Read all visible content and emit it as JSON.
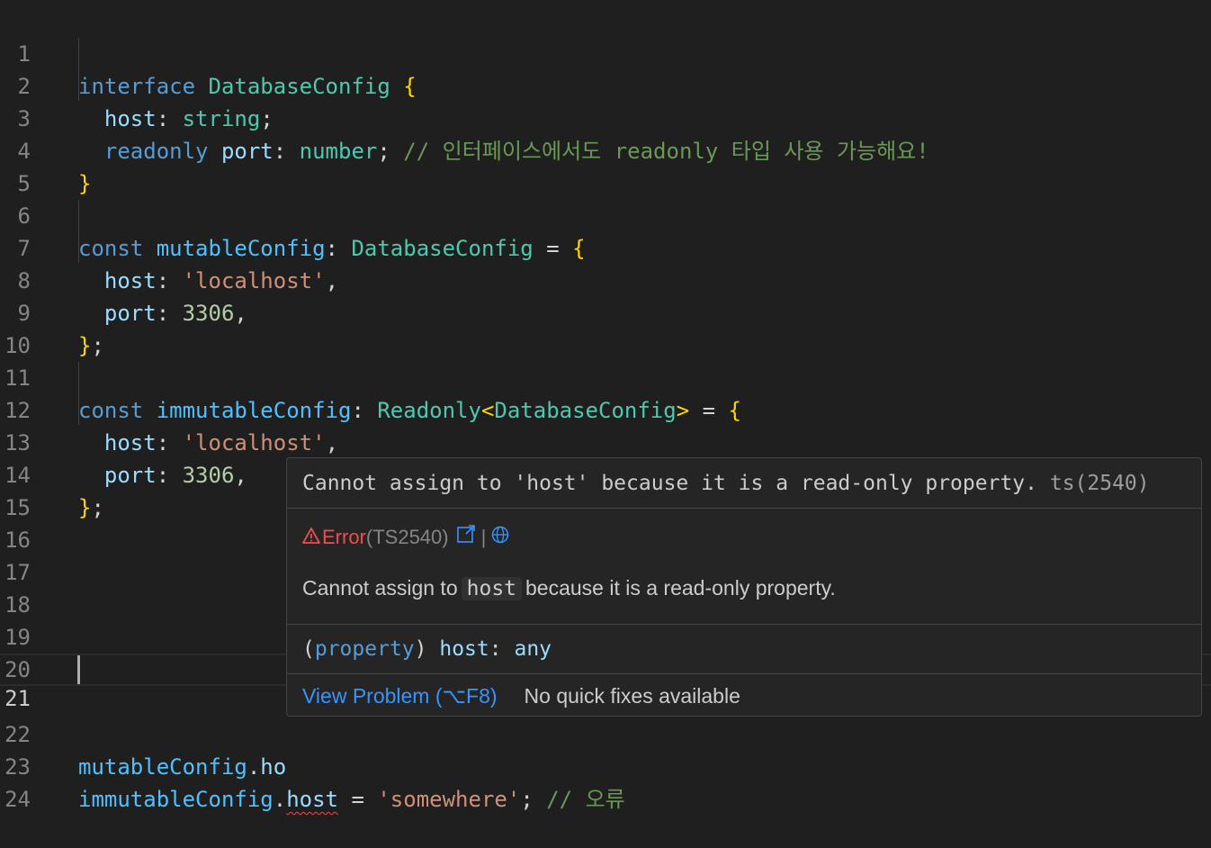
{
  "editor": {
    "line_numbers": [
      "1",
      "2",
      "3",
      "4",
      "5",
      "6",
      "7",
      "8",
      "9",
      "10",
      "11",
      "12",
      "13",
      "14",
      "15",
      "16",
      "17",
      "18",
      "19",
      "20",
      "21",
      "22",
      "23",
      "24"
    ],
    "tokens": {
      "l1": [
        "interface",
        "DatabaseConfig",
        "{"
      ],
      "l2": [
        "host",
        ":",
        "string",
        ";"
      ],
      "l3": [
        "readonly",
        "port",
        ":",
        "number",
        ";",
        "// 인터페이스에서도 readonly 타입 사용 가능해요!"
      ],
      "l4": [
        "}"
      ],
      "l6": [
        "const",
        "mutableConfig",
        ":",
        "DatabaseConfig",
        "=",
        "{"
      ],
      "l7": [
        "host",
        ":",
        "'localhost'",
        ","
      ],
      "l8": [
        "port",
        ":",
        "3306",
        ","
      ],
      "l9": [
        "}",
        ";"
      ],
      "l11": [
        "const",
        "immutableConfig",
        ":",
        "Readonly",
        "<",
        "DatabaseConfig",
        ">",
        "=",
        "{"
      ],
      "l12": [
        "host",
        ":",
        "'localhost'",
        ","
      ],
      "l13": [
        "port",
        ":",
        "3306",
        ","
      ],
      "l14": [
        "}",
        ";"
      ],
      "l22": [
        "mutableConfig",
        ".",
        "ho"
      ],
      "l23": [
        "immutableConfig",
        ".",
        "host",
        "=",
        "'somewhere'",
        ";",
        "// 오류"
      ]
    }
  },
  "hover": {
    "message": "Cannot assign to 'host' because it is a read-only property.",
    "ts_code": "ts(2540)",
    "error_icon": "warning-triangle-icon",
    "error_label": "Error",
    "error_code": "(TS2540)",
    "separator": "|",
    "detail_prefix": "Cannot assign to",
    "detail_code": "host",
    "detail_suffix": "because it is a read-only property.",
    "signature": {
      "open": "(",
      "kind": "property",
      "close": ")",
      "name": "host",
      "colon": ":",
      "type": "any"
    },
    "view_problem": "View Problem (⌥F8)",
    "no_fixes": "No quick fixes available"
  },
  "colors": {
    "background": "#1f1f1f",
    "keyword": "#569cd6",
    "type": "#4ec9b0",
    "string": "#ce9178",
    "number": "#b5cea8",
    "comment": "#6a9955",
    "error": "#f14c4c",
    "link": "#3794ff"
  }
}
